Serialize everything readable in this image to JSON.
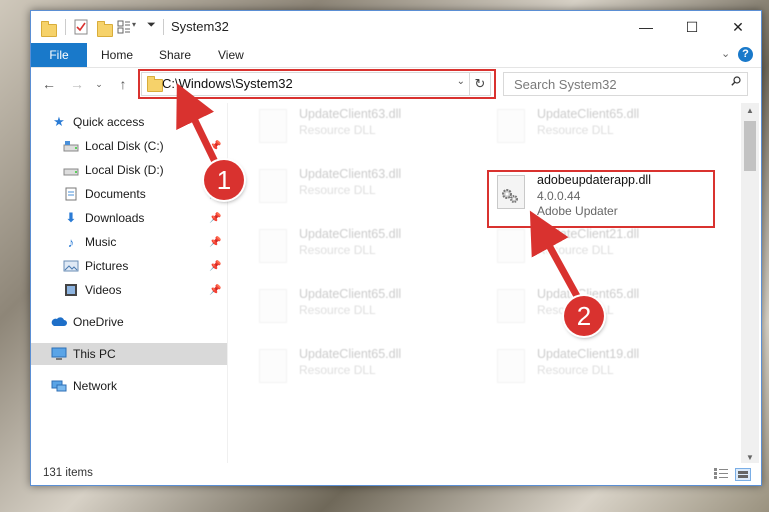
{
  "window": {
    "title": "System32",
    "controls": {
      "minimize": "—",
      "maximize": "☐",
      "close": "✕"
    }
  },
  "ribbon": {
    "tabs": [
      "File",
      "Home",
      "Share",
      "View"
    ],
    "expand": "⌄",
    "help": "?"
  },
  "nav": {
    "back": "←",
    "forward": "→",
    "recent": "⌄",
    "up": "↑",
    "address": "C:\\Windows\\System32",
    "address_dropdown": "⌄",
    "refresh": "↻",
    "search_placeholder": "Search System32"
  },
  "sidebar": {
    "items": [
      {
        "label": "Quick access",
        "icon": "star-icon",
        "pinned": false
      },
      {
        "label": "Local Disk (C:)",
        "icon": "drive-icon",
        "pinned": true
      },
      {
        "label": "Local Disk (D:)",
        "icon": "drive-icon",
        "pinned": true
      },
      {
        "label": "Documents",
        "icon": "documents-icon",
        "pinned": true
      },
      {
        "label": "Downloads",
        "icon": "download-icon",
        "pinned": true
      },
      {
        "label": "Music",
        "icon": "music-icon",
        "pinned": true
      },
      {
        "label": "Pictures",
        "icon": "pictures-icon",
        "pinned": true
      },
      {
        "label": "Videos",
        "icon": "videos-icon",
        "pinned": true
      },
      {
        "label": "OneDrive",
        "icon": "cloud-icon",
        "pinned": false
      },
      {
        "label": "This PC",
        "icon": "computer-icon",
        "pinned": false,
        "selected": true
      },
      {
        "label": "Network",
        "icon": "network-icon",
        "pinned": false
      }
    ],
    "pin_glyph": "📌"
  },
  "files": [
    {
      "name": "UpdateClient63.dll",
      "type": "Resource DLL"
    },
    {
      "name": "UpdateClient65.dll",
      "type": "Resource DLL"
    },
    {
      "name": "UpdateClient63.dll",
      "type": "Resource DLL"
    },
    {
      "name": "adobeupdaterapp.dll",
      "version": "4.0.0.44",
      "type": "Adobe Updater",
      "highlighted": true
    },
    {
      "name": "UpdateClient65.dll",
      "type": "Resource DLL"
    },
    {
      "name": "UpdateClient21.dll",
      "type": "Resource DLL"
    },
    {
      "name": "UpdateClient65.dll",
      "type": "Resource DLL"
    },
    {
      "name": "UpdateClient65.dll",
      "type": "Resource DLL"
    },
    {
      "name": "UpdateClient65.dll",
      "type": "Resource DLL"
    },
    {
      "name": "UpdateClient19.dll",
      "type": "Resource DLL"
    }
  ],
  "status": {
    "item_count": "131 items"
  },
  "annotations": {
    "step1": "1",
    "step2": "2",
    "color": "#d9322f"
  }
}
